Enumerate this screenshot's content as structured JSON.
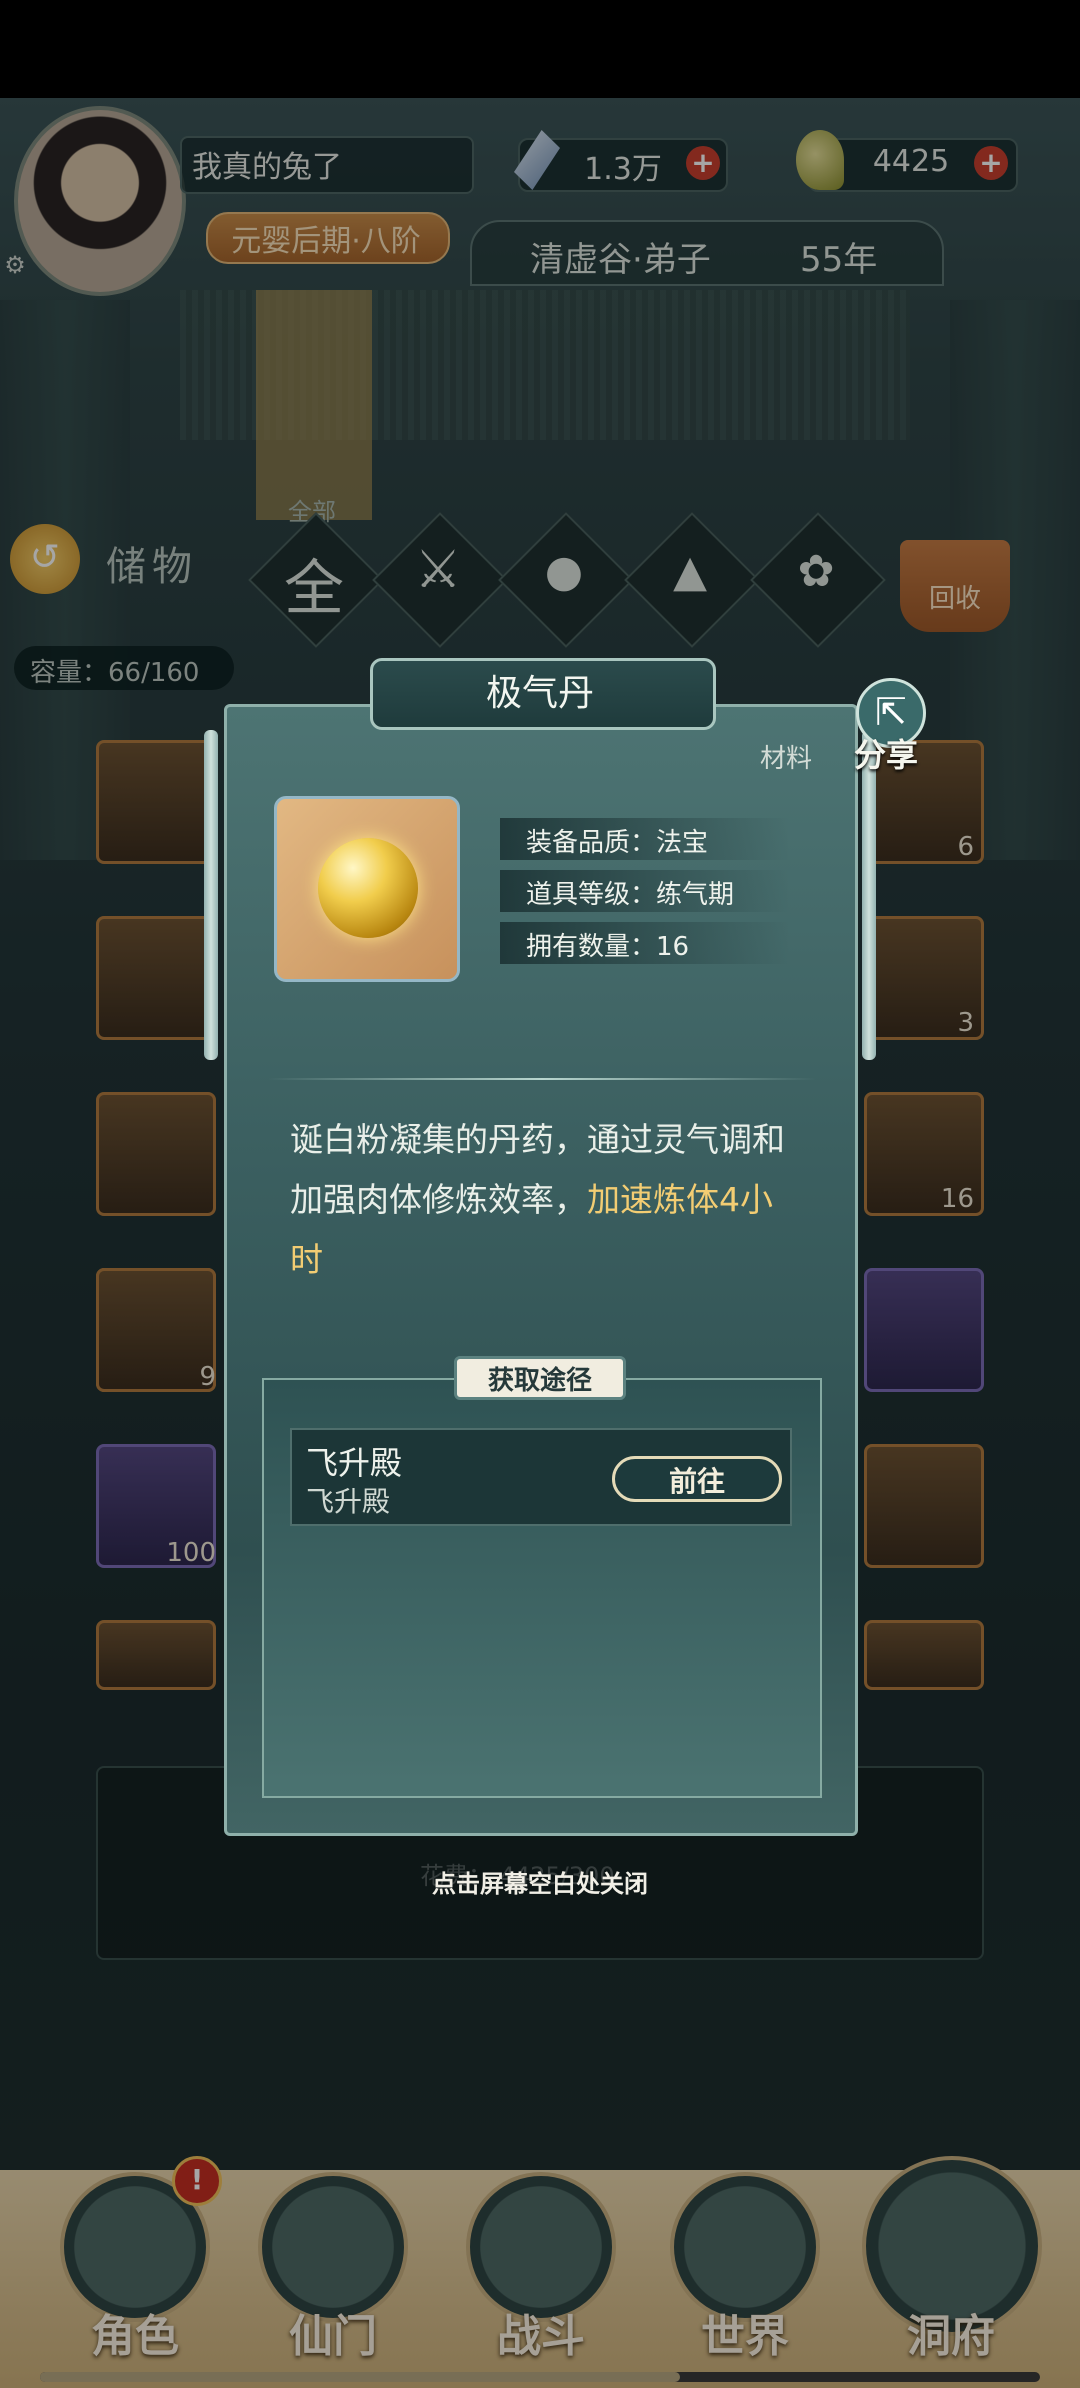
{
  "header": {
    "player_name": "我真的兔了",
    "realm": "元婴后期·八阶",
    "spirit_stones": "1.3万",
    "currency": "4425",
    "sect": "清虚谷·弟子",
    "years": "55年"
  },
  "storage": {
    "title": "储物",
    "all_label": "全部",
    "tabs": [
      "全",
      "⚔",
      "●",
      "▲",
      "✿"
    ],
    "recycle_label": "回收",
    "capacity": "容量：66/160",
    "grid_counts": [
      "6",
      "3",
      "16",
      "9",
      "100"
    ]
  },
  "modal": {
    "title": "极气丹",
    "share_label": "分享",
    "item_type": "材料",
    "stats": [
      "装备品质：法宝",
      "道具等级：练气期",
      "拥有数量：16"
    ],
    "description": "诞白粉凝集的丹药，通过灵气调和加强肉体修炼效率，",
    "description_highlight": "加速炼体4小时",
    "source_title": "获取途径",
    "sources": [
      {
        "name": "飞升殿",
        "sub": "飞升殿",
        "button": "前往"
      }
    ],
    "close_hint": "点击屏幕空白处关闭",
    "background_cost": "花费：  4425/300"
  },
  "nav": {
    "items": [
      "角色",
      "仙门",
      "战斗",
      "世界",
      "洞府"
    ],
    "alert": "!"
  },
  "colors": {
    "highlight": "#f3cd73",
    "alert": "#c62f22",
    "modal": "#3b5f60"
  }
}
